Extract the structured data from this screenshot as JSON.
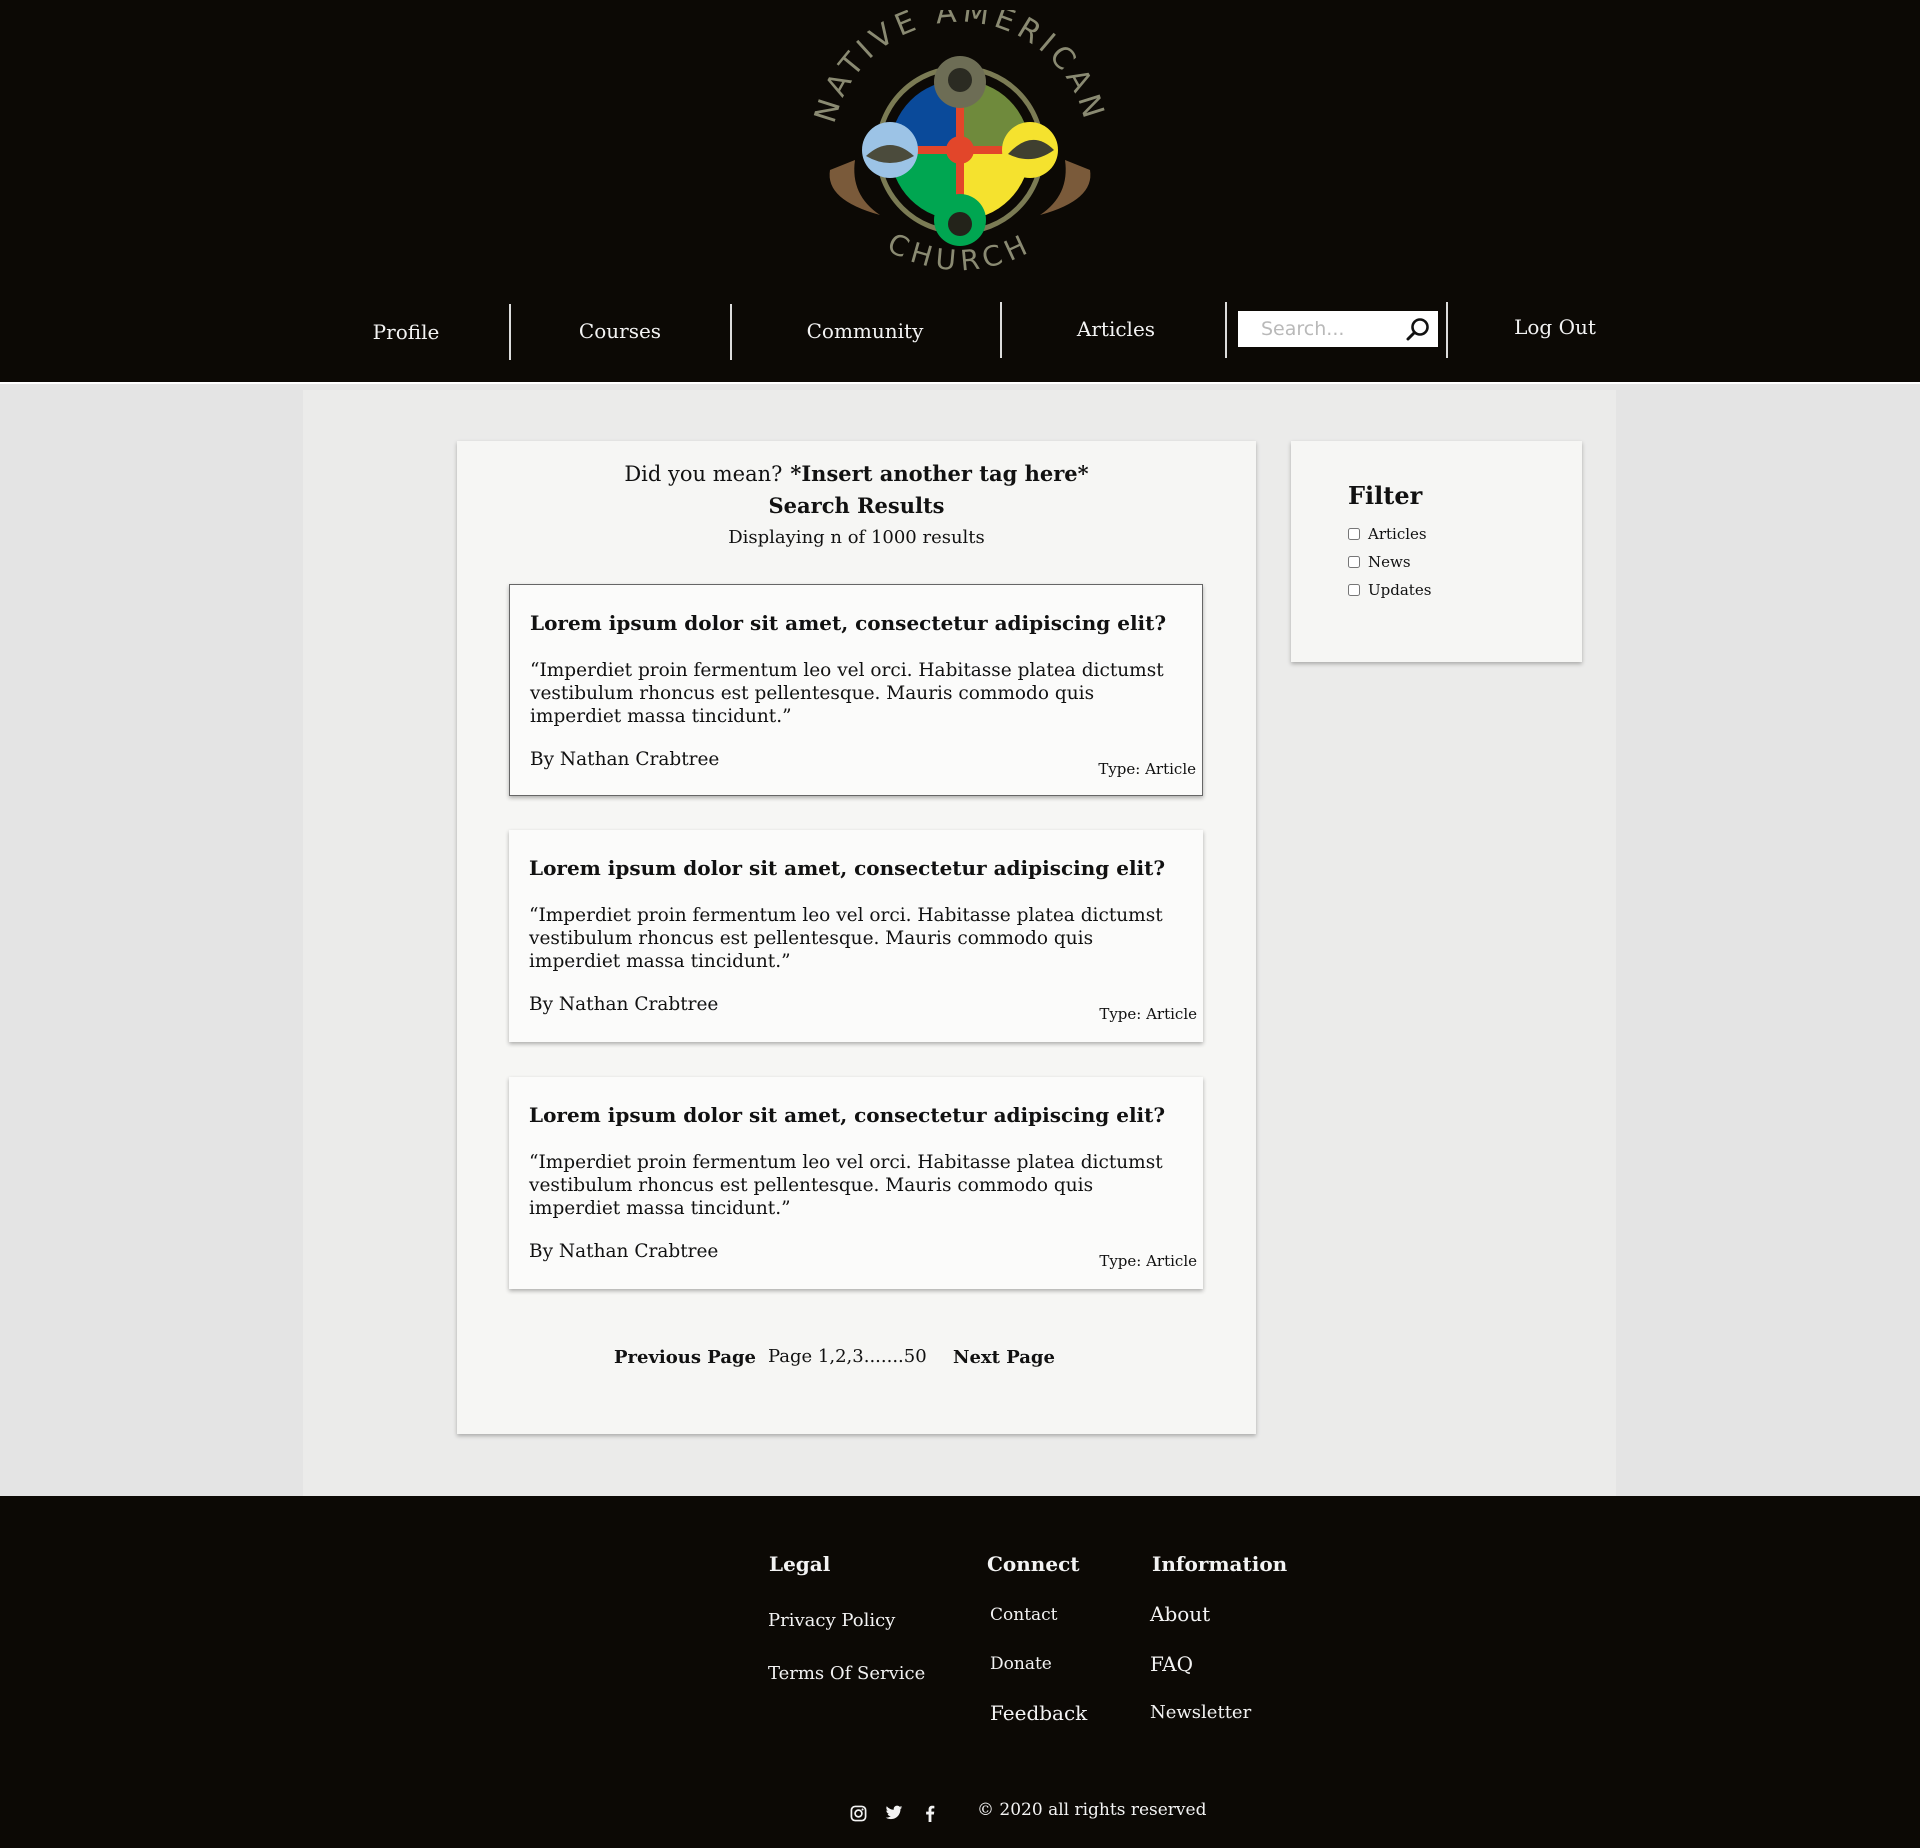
{
  "header": {
    "logo_text_top": "NATIVE AMERICAN",
    "logo_text_bottom": "CHURCH",
    "nav": {
      "profile": "Profile",
      "courses": "Courses",
      "community": "Community",
      "articles": "Articles",
      "logout": "Log Out"
    },
    "search": {
      "placeholder": "Search...",
      "value": "",
      "icon": "search-icon"
    }
  },
  "results": {
    "did_you_mean_label": "Did you mean?",
    "did_you_mean_tag": "*Insert another tag here*",
    "title": "Search Results",
    "count_text": "Displaying n of 1000 results",
    "items": [
      {
        "title": "Lorem ipsum dolor sit amet, consectetur adipiscing elit?",
        "quote": "“Imperdiet proin fermentum leo vel orci. Habitasse platea dictumst vestibulum rhoncus est pellentesque. Mauris commodo quis imperdiet massa tincidunt.”",
        "author": "By Nathan Crabtree",
        "type": "Type: Article"
      },
      {
        "title": "Lorem ipsum dolor sit amet, consectetur adipiscing elit?",
        "quote": "“Imperdiet proin fermentum leo vel orci. Habitasse platea dictumst vestibulum rhoncus est pellentesque. Mauris commodo quis imperdiet massa tincidunt.”",
        "author": "By Nathan Crabtree",
        "type": "Type: Article"
      },
      {
        "title": "Lorem ipsum dolor sit amet, consectetur adipiscing elit?",
        "quote": "“Imperdiet proin fermentum leo vel orci. Habitasse platea dictumst vestibulum rhoncus est pellentesque. Mauris commodo quis imperdiet massa tincidunt.”",
        "author": "By Nathan Crabtree",
        "type": "Type: Article"
      }
    ],
    "pagination": {
      "previous": "Previous Page",
      "pages": "Page 1,2,3.......50",
      "next": "Next Page"
    }
  },
  "filter": {
    "title": "Filter",
    "options": [
      {
        "label": "Articles",
        "checked": false
      },
      {
        "label": "News",
        "checked": false
      },
      {
        "label": "Updates",
        "checked": false
      }
    ]
  },
  "footer": {
    "legal": {
      "heading": "Legal",
      "links": [
        "Privacy Policy",
        "Terms Of Service"
      ]
    },
    "connect": {
      "heading": "Connect",
      "links": [
        "Contact",
        "Donate",
        "Feedback"
      ]
    },
    "information": {
      "heading": "Information",
      "links": [
        "About",
        "FAQ",
        "Newsletter"
      ]
    },
    "social_icons": [
      "instagram-icon",
      "twitter-icon",
      "facebook-icon"
    ],
    "copyright": "© 2020 all rights reserved"
  },
  "colors": {
    "header_bg": "#0c0905",
    "page_bg": "#e4e4e4",
    "content_bg": "#ebebea",
    "panel_bg": "#f6f6f4",
    "card_bg": "#fbfbfa",
    "logo_text": "#8a8a72",
    "logo_blue": "#0a4a9a",
    "logo_yellow": "#f5e22e",
    "logo_green": "#00a651",
    "logo_red": "#e2462a"
  }
}
